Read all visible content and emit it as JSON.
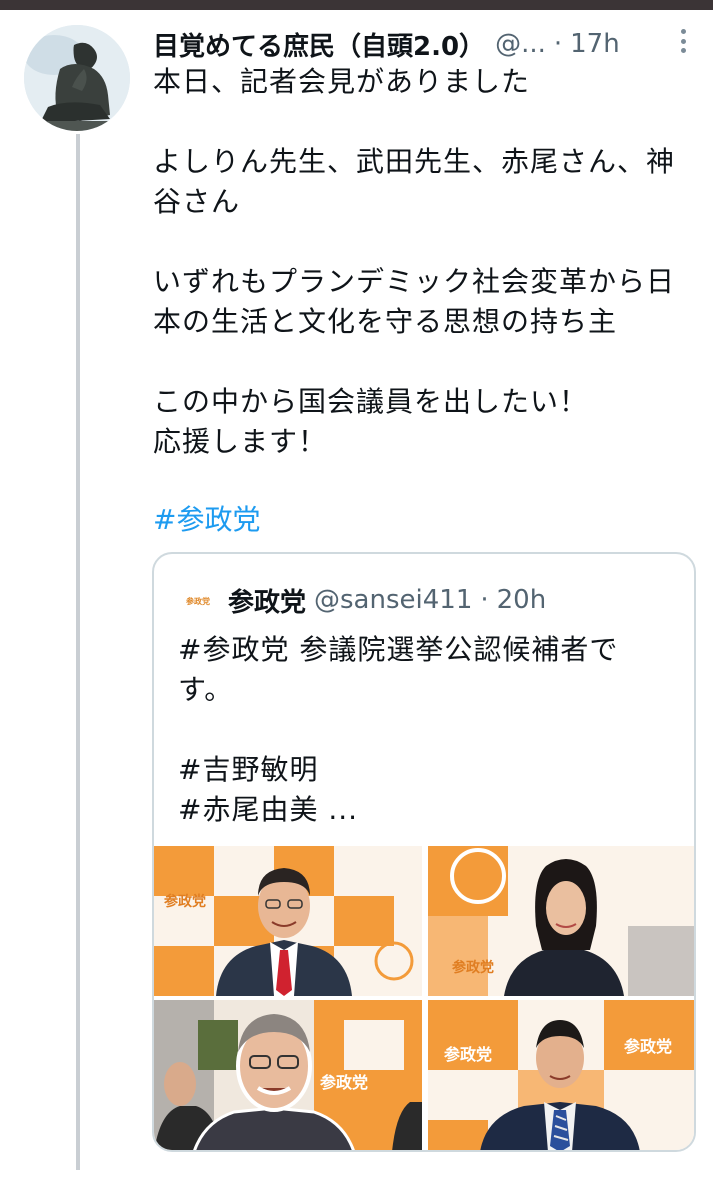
{
  "tweet": {
    "display_name": "目覚めてる庶民（自頭2.0）",
    "handle": "@...",
    "separator": "·",
    "time": "17h",
    "lines": [
      "本日、記者会見がありました",
      "",
      "よしりん先生、武田先生、赤尾さん、神",
      "谷さん",
      "",
      "いずれもプランデミック社会変革から日",
      "本の生活と文化を守る思想の持ち主",
      "",
      "この中から国会議員を出したい！",
      "応援します！"
    ],
    "hashtag": "#参政党",
    "avatar_icon": "thinker-statue-avatar",
    "more_icon": "more-vertical-icon"
  },
  "quote": {
    "logo_text": "参政党",
    "name": "参政党",
    "handle": "@sansei411",
    "separator": "·",
    "time": "20h",
    "lines": [
      "#参政党 参議院選挙公認候補者で",
      "す。",
      "",
      "#吉野敏明",
      "#赤尾由美 ..."
    ],
    "photos": [
      {
        "icon": "photo-man-red-tie",
        "banner": "参政党"
      },
      {
        "icon": "photo-woman-dark-suit",
        "banner": "参政党"
      },
      {
        "icon": "photo-man-glasses-cutout",
        "banner": "参政党"
      },
      {
        "icon": "photo-man-blue-tie",
        "banner": "参政党"
      }
    ]
  },
  "colors": {
    "link": "#1d9bf0",
    "secondary_text": "#536471",
    "border": "#cfd9de",
    "brand_orange": "#f39b3a"
  }
}
